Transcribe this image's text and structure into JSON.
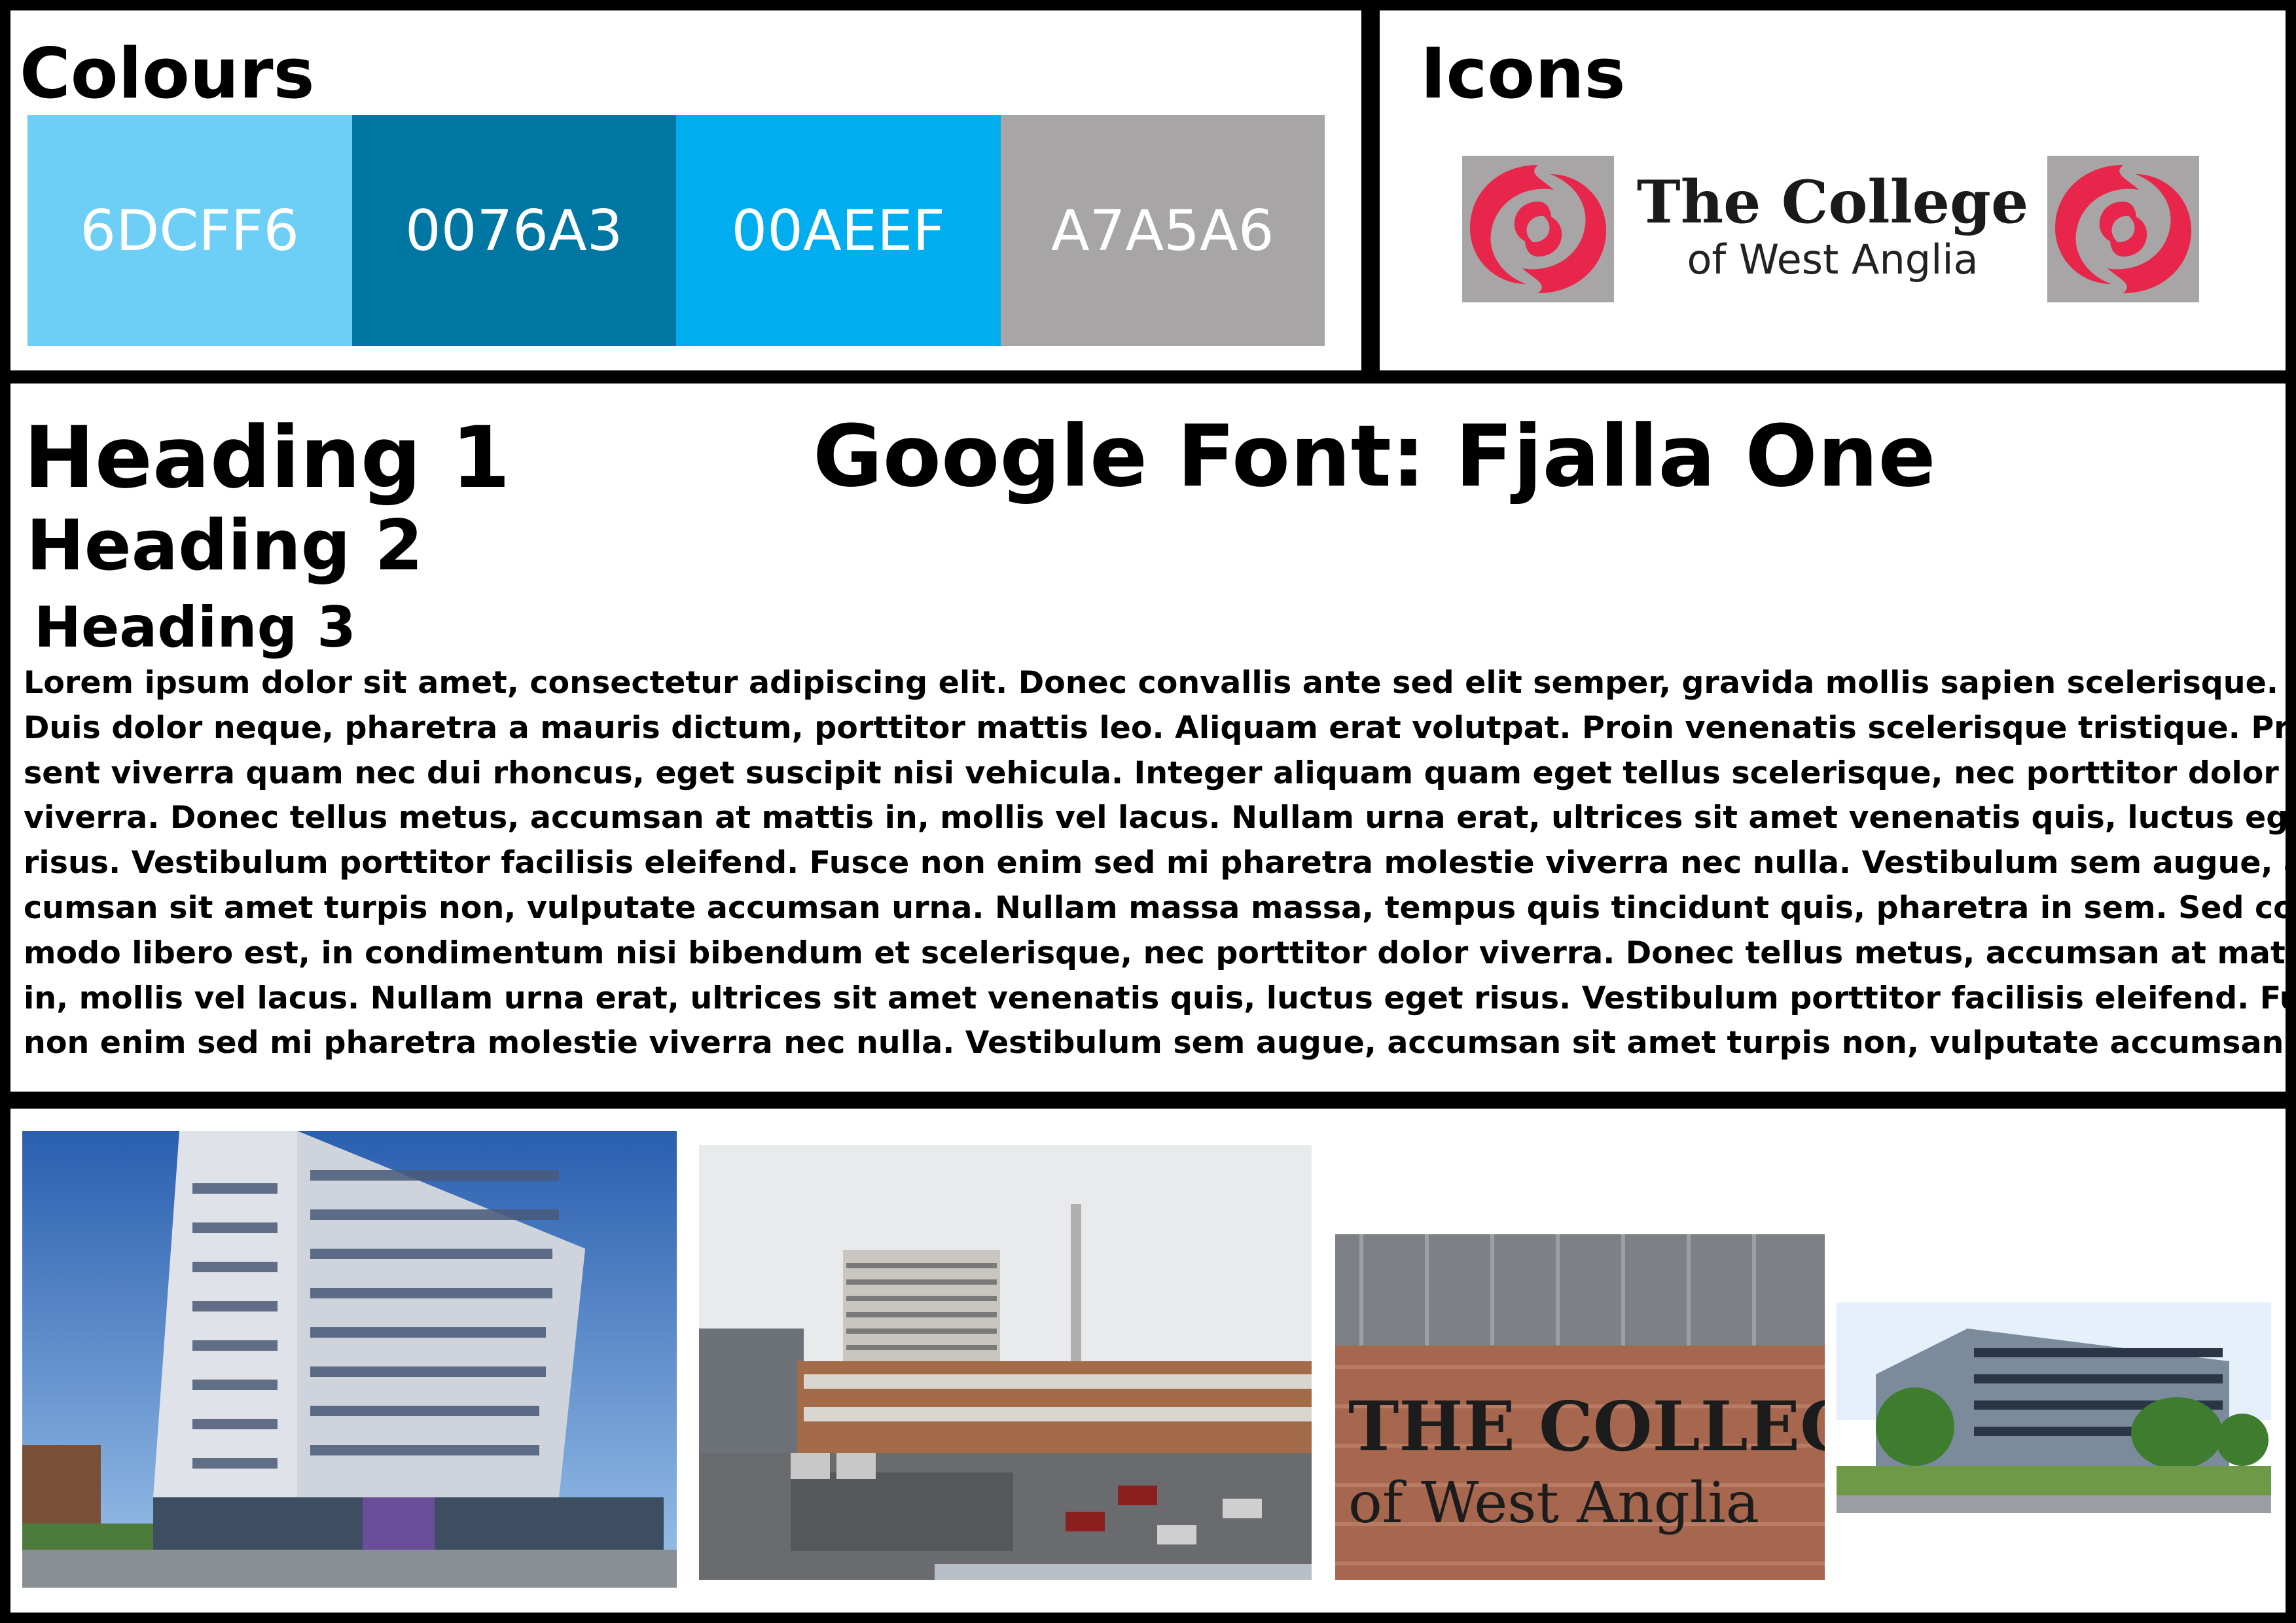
{
  "colours": {
    "title": "Colours",
    "swatches": [
      {
        "label": "6DCFF6",
        "color": "#6DCFF6"
      },
      {
        "label": "0076A3",
        "color": "#0076A3"
      },
      {
        "label": "00AEEF",
        "color": "#00AEEF"
      },
      {
        "label": "A7A5A6",
        "color": "#A7A5A6"
      }
    ]
  },
  "icons": {
    "title": "Icons",
    "logo": {
      "name": "The College",
      "sub": "of West Anglia",
      "swirl_color": "#E8254A",
      "swirl_bg": "#A7A5A6",
      "icon": "swirl-logo-icon"
    }
  },
  "typography": {
    "heading1": "Heading 1",
    "heading2": "Heading 2",
    "heading3": "Heading 3",
    "font_note": "Google Font: Fjalla One",
    "body_lines": [
      "Lorem ipsum dolor sit amet, consectetur adipiscing elit. Donec convallis ante sed elit semper, gravida mollis sapien scelerisque.",
      "Duis dolor neque, pharetra a mauris dictum, porttitor mattis leo. Aliquam erat volutpat. Proin venenatis scelerisque tristique. Prae-",
      "sent viverra quam nec dui rhoncus, eget suscipit nisi vehicula. Integer aliquam quam eget tellus scelerisque, nec porttitor dolor",
      "viverra. Donec tellus metus, accumsan at mattis in, mollis vel lacus. Nullam urna erat, ultrices sit amet venenatis quis, luctus eget",
      "risus. Vestibulum porttitor facilisis eleifend. Fusce non enim sed mi pharetra molestie viverra nec nulla. Vestibulum sem augue, ac-",
      "cumsan sit amet turpis non, vulputate accumsan urna. Nullam massa massa, tempus quis tincidunt quis, pharetra in sem. Sed com-",
      "modo libero est, in condimentum nisi bibendum et scelerisque, nec porttitor dolor viverra. Donec tellus metus, accumsan at mattis",
      "in, mollis vel lacus. Nullam urna erat, ultrices sit amet venenatis quis, luctus eget risus. Vestibulum porttitor facilisis eleifend. Fusce",
      "non enim sed mi pharetra molestie viverra nec nulla. Vestibulum sem augue, accumsan sit amet turpis non, vulputate accumsan"
    ]
  },
  "photos": {
    "sign_line1": "THE COLLEGE",
    "sign_line2": "of West Anglia"
  }
}
